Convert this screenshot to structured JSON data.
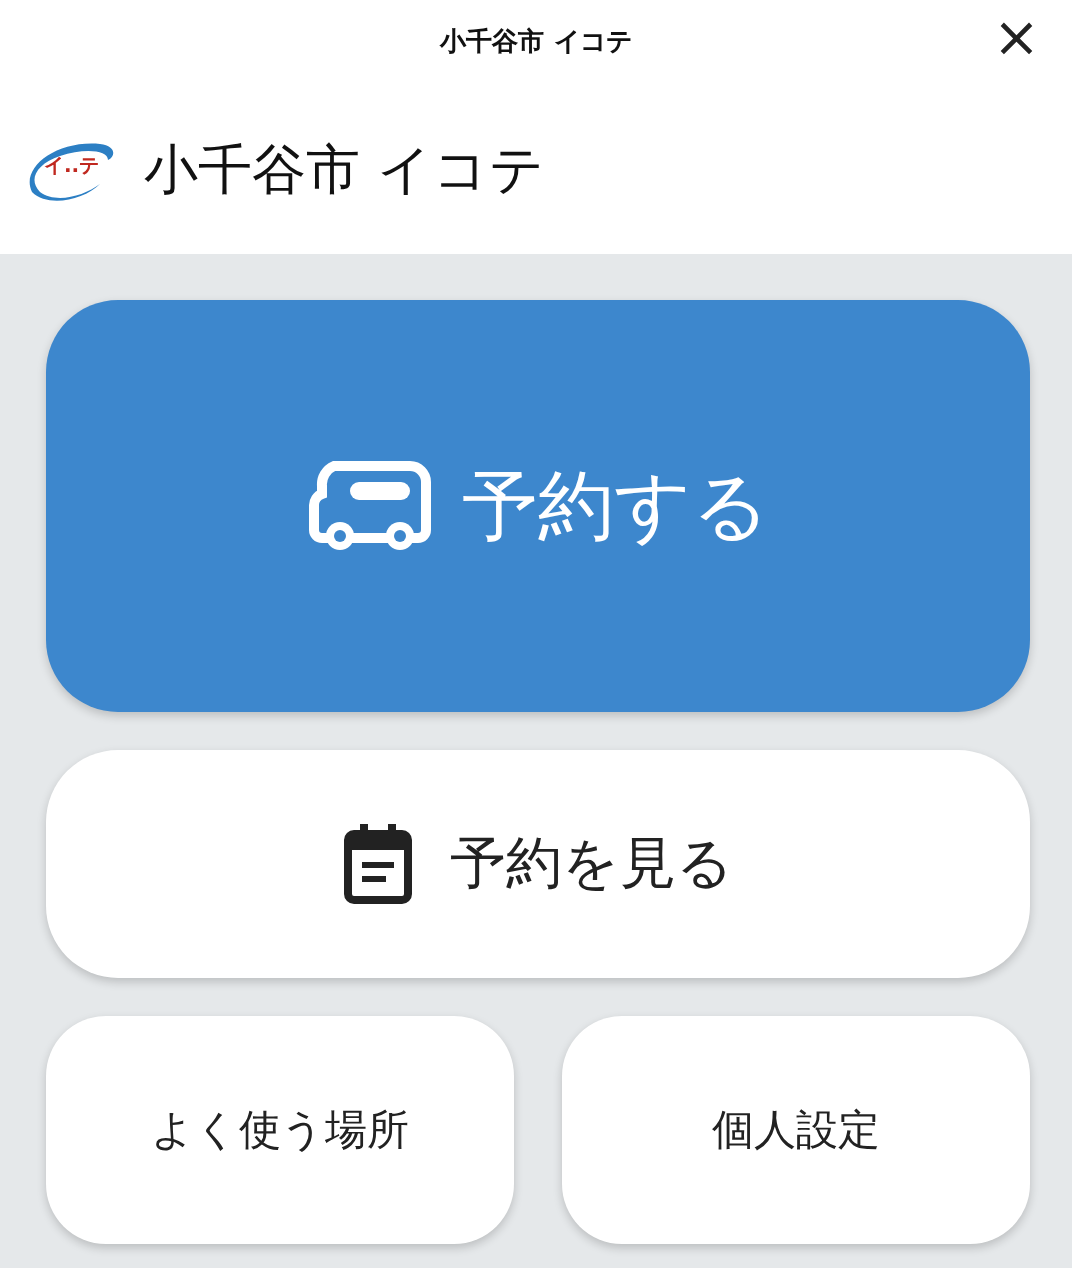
{
  "top_bar": {
    "title": "小千谷市 イコテ",
    "close": "×"
  },
  "header": {
    "logo_text": "イ..テ",
    "title": "小千谷市 イコテ"
  },
  "buttons": [
    {
      "kind": "primary",
      "label": "予約する"
    },
    {
      "kind": "secondary",
      "label": "予約を見る"
    },
    {
      "kind": "small",
      "label": "よく使う場所"
    },
    {
      "kind": "small",
      "label": "個人設定"
    }
  ]
}
